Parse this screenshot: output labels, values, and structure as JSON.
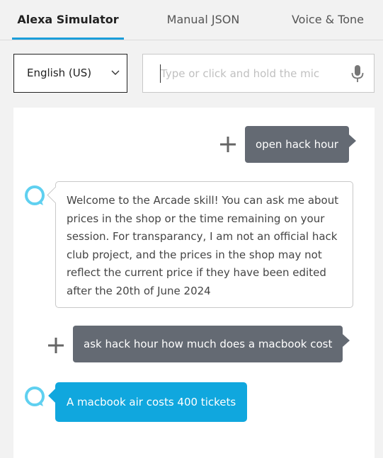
{
  "tabs": [
    {
      "label": "Alexa Simulator",
      "active": true
    },
    {
      "label": "Manual JSON",
      "active": false
    },
    {
      "label": "Voice & Tone",
      "active": false
    }
  ],
  "locale": {
    "selected": "English (US)",
    "icon": "chevron-down-icon"
  },
  "utterance_input": {
    "placeholder": "Type or click and hold the mic",
    "value": "",
    "icon": "microphone-icon"
  },
  "conversation": [
    {
      "speaker": "user",
      "text": "open hack hour"
    },
    {
      "speaker": "alexa",
      "text": "Welcome to the Arcade skill! You can ask me about prices in the shop or the time remaining on your session. For transparancy, I am not an official hack club project, and the prices in the shop may not reflect the current price if they have been edited after the 20th of June 2024"
    },
    {
      "speaker": "user",
      "text": "ask hack hour how much does a macbook cost"
    },
    {
      "speaker": "alexa",
      "text": "A macbook air costs 400 tickets"
    }
  ],
  "colors": {
    "accent": "#1a9dd9",
    "user_bubble": "#646a73",
    "alexa_highlight": "#10a7de",
    "alexa_ring": "#5fd0f0"
  }
}
